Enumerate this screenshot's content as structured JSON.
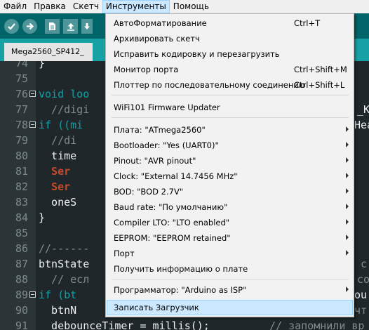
{
  "menubar": {
    "items": [
      "Файл",
      "Правка",
      "Скетч",
      "Инструменты",
      "Помощь"
    ],
    "open_index": 3
  },
  "tab": {
    "title": "Mega2560_SP412_"
  },
  "editor": {
    "line_numbers": [
      "74",
      "75",
      "76",
      "77",
      "78",
      "79",
      "80",
      "81",
      "82",
      "83",
      "84",
      "85",
      "86",
      "87",
      "88",
      "89",
      "90",
      "91"
    ],
    "lines": [
      "}",
      "",
      "void loo",
      "  //digi",
      "if ((mi",
      "  //di",
      "  time",
      "  Ser",
      "  Ser",
      "  oneS",
      "}",
      "",
      "//------",
      "btnState",
      "  // есл",
      "if (bt",
      "  btnN",
      "  debounceTimer = millis();"
    ],
    "right_fragments": {
      "77": "_K",
      "78": "Hea",
      "87": "с",
      "88": "со",
      "89": "ou",
      "90": "чт",
      "91": "// запомнили вр"
    }
  },
  "dropdown": {
    "items": [
      {
        "label": "АвтоФорматирование",
        "shortcut": "Ctrl+T",
        "submenu": false
      },
      {
        "label": "Архивировать скетч",
        "shortcut": "",
        "submenu": false
      },
      {
        "label": "Исправить кодировку и перезагрузить",
        "shortcut": "",
        "submenu": false
      },
      {
        "label": "Монитор порта",
        "shortcut": "Ctrl+Shift+M",
        "submenu": false
      },
      {
        "label": "Плоттер по последовательному соединению",
        "shortcut": "Ctrl+Shift+L",
        "submenu": false
      },
      {
        "label": "WiFi101 Firmware Updater",
        "shortcut": "",
        "submenu": false
      },
      {
        "label": "Плата: \"ATmega2560\"",
        "shortcut": "",
        "submenu": true
      },
      {
        "label": "Bootloader: \"Yes (UART0)\"",
        "shortcut": "",
        "submenu": true
      },
      {
        "label": "Pinout: \"AVR pinout\"",
        "shortcut": "",
        "submenu": true
      },
      {
        "label": "Clock: \"External 14.7456 MHz\"",
        "shortcut": "",
        "submenu": true
      },
      {
        "label": "BOD: \"BOD 2.7V\"",
        "shortcut": "",
        "submenu": true
      },
      {
        "label": "Baud rate: \"По умолчанию\"",
        "shortcut": "",
        "submenu": true
      },
      {
        "label": "Compiler LTO: \"LTO enabled\"",
        "shortcut": "",
        "submenu": true
      },
      {
        "label": "EEPROM: \"EEPROM retained\"",
        "shortcut": "",
        "submenu": true
      },
      {
        "label": "Порт",
        "shortcut": "",
        "submenu": true
      },
      {
        "label": "Получить информацию о плате",
        "shortcut": "",
        "submenu": false
      },
      {
        "label": "Программатор: \"Arduino as ISP\"",
        "shortcut": "",
        "submenu": true
      },
      {
        "label": "Записать Загрузчик",
        "shortcut": "",
        "submenu": false,
        "highlighted": true
      }
    ]
  },
  "colors": {
    "toolbar": "#006468",
    "tabbar": "#17a1a5",
    "editor_bg": "#1f272a",
    "keyword": "#0ca1a6",
    "menu_highlight": "#cce8ff"
  }
}
